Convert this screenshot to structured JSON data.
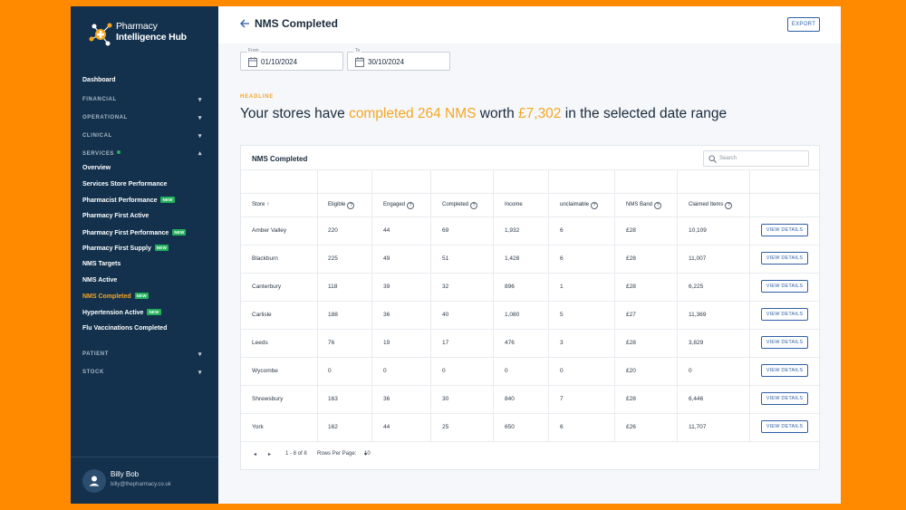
{
  "app": {
    "logo_line1": "Pharmacy",
    "logo_line2": "Intelligence Hub"
  },
  "sidebar": {
    "dashboard": "Dashboard",
    "sections": {
      "financial": "FINANCIAL",
      "operational": "OPERATIONAL",
      "clinical": "CLINICAL",
      "services": "SERVICES",
      "patient": "PATIENT",
      "stock": "STOCK"
    },
    "services_items": [
      {
        "label": "Overview",
        "new": false
      },
      {
        "label": "Services Store Performance",
        "new": false
      },
      {
        "label": "Pharmacist Performance",
        "new": true
      },
      {
        "label": "Pharmacy First Active",
        "new": false
      },
      {
        "label": "Pharmacy First Performance",
        "new": true
      },
      {
        "label": "Pharmacy First Supply",
        "new": true
      },
      {
        "label": "NMS Targets",
        "new": false
      },
      {
        "label": "NMS Active",
        "new": false
      },
      {
        "label": "NMS Completed",
        "new": true,
        "active": true
      },
      {
        "label": "Hypertension Active",
        "new": true
      },
      {
        "label": "Flu Vaccinations Completed",
        "new": false
      }
    ],
    "new_badge": "NEW",
    "user": {
      "name": "Billy Bob",
      "email": "billy@thepharmacy.co.uk"
    }
  },
  "header": {
    "title": "NMS Completed",
    "export_label": "EXPORT"
  },
  "filters": {
    "from_label": "From",
    "from_value": "01/10/2024",
    "to_label": "To",
    "to_value": "30/10/2024"
  },
  "headline": {
    "label": "HEADLINE",
    "prefix": "Your stores have ",
    "completed_text": "completed 264 NMS",
    "middle": " worth ",
    "worth_text": "£7,302",
    "suffix": " in the selected date range"
  },
  "table": {
    "title": "NMS Completed",
    "search_placeholder": "Search",
    "columns": [
      "Store",
      "Eligible",
      "Engaged",
      "Completed",
      "Income",
      "unclaimable",
      "NMS Band",
      "Claimed Items"
    ],
    "sort_indicator": "↑",
    "view_label": "VIEW DETAILS",
    "rows": [
      [
        "Amber Valley",
        "220",
        "44",
        "69",
        "1,932",
        "6",
        "£28",
        "10,109"
      ],
      [
        "Blackburn",
        "225",
        "49",
        "51",
        "1,428",
        "6",
        "£28",
        "11,007"
      ],
      [
        "Canterbury",
        "118",
        "39",
        "32",
        "896",
        "1",
        "£28",
        "6,225"
      ],
      [
        "Carlisle",
        "188",
        "36",
        "40",
        "1,080",
        "5",
        "£27",
        "11,369"
      ],
      [
        "Leeds",
        "76",
        "19",
        "17",
        "476",
        "3",
        "£28",
        "3,829"
      ],
      [
        "Wycombe",
        "0",
        "0",
        "0",
        "0",
        "0",
        "£20",
        "0"
      ],
      [
        "Shrewsbury",
        "163",
        "36",
        "30",
        "840",
        "7",
        "£28",
        "6,446"
      ],
      [
        "York",
        "162",
        "44",
        "25",
        "650",
        "6",
        "£26",
        "11,707"
      ]
    ]
  },
  "pagination": {
    "range": "1 - 8 of 8",
    "rows_per_page_label": "Rows Per Page:",
    "rows_per_page": "10"
  },
  "colors": {
    "sidebar": "#13314d",
    "accent": "#f5a623",
    "primary": "#2f5fa8",
    "page_bg": "#ff8a00"
  }
}
